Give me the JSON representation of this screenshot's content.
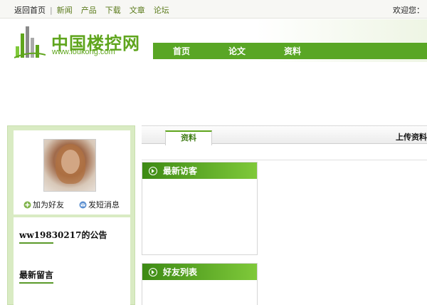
{
  "topnav": {
    "home": "返回首页",
    "separator": "|",
    "items": [
      "新闻",
      "产品",
      "下载",
      "文章",
      "论坛"
    ],
    "welcome": "欢迎您："
  },
  "header": {
    "logo_cn": "中国楼控网",
    "logo_url": "www.loukong.com"
  },
  "mainnav": {
    "items": [
      "首页",
      "论文",
      "资料"
    ]
  },
  "profile": {
    "add_friend": "加为好友",
    "send_message": "发短消息"
  },
  "sidebar": {
    "notice_title": "ww19830217的公告",
    "messages_title": "最新留言"
  },
  "content": {
    "active_tab": "资料",
    "upload_label": "上传资料",
    "visitors_title": "最新访客",
    "friends_title": "好友列表"
  },
  "colors": {
    "brand_green": "#5fa51d",
    "nav_green": "#59a625"
  }
}
